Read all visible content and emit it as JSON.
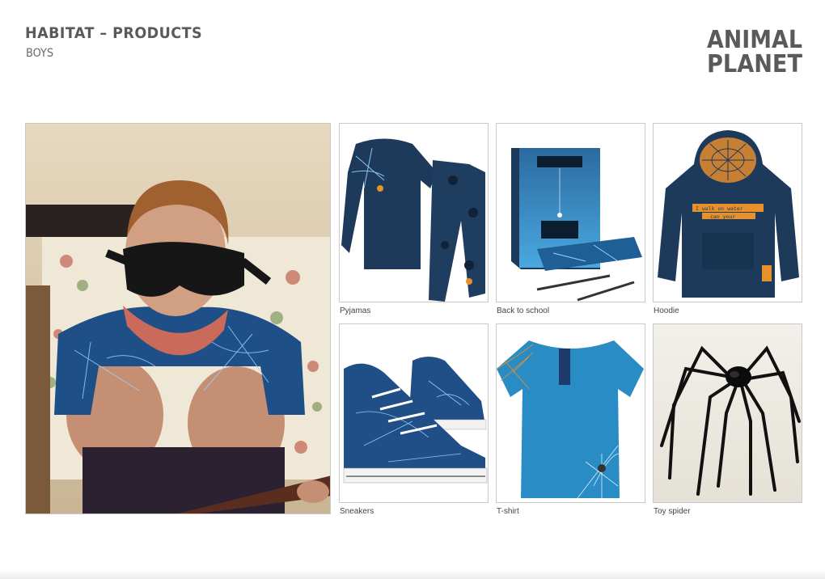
{
  "header": {
    "title": "HABITAT – PRODUCTS",
    "subtitle": "BOYS"
  },
  "logo": {
    "line1": "ANIMAL",
    "line2": "PLANET"
  },
  "hero": {
    "icon": "boy-with-goggles-photo"
  },
  "products": [
    {
      "caption": "Pyjamas",
      "icon": "pyjamas-photo"
    },
    {
      "caption": "Back to school",
      "icon": "school-supplies-photo"
    },
    {
      "caption": "Hoodie",
      "icon": "hoodie-photo"
    },
    {
      "caption": "Sneakers",
      "icon": "sneakers-photo"
    },
    {
      "caption": "T-shirt",
      "icon": "tshirt-photo"
    },
    {
      "caption": "Toy spider",
      "icon": "toy-spider-photo"
    }
  ],
  "hoodie_print": "I walk on water can your",
  "colors": {
    "navy": "#1d3a5a",
    "blue": "#2a8cc4",
    "orange": "#e8902a",
    "title_grey": "#5a5a5a"
  }
}
